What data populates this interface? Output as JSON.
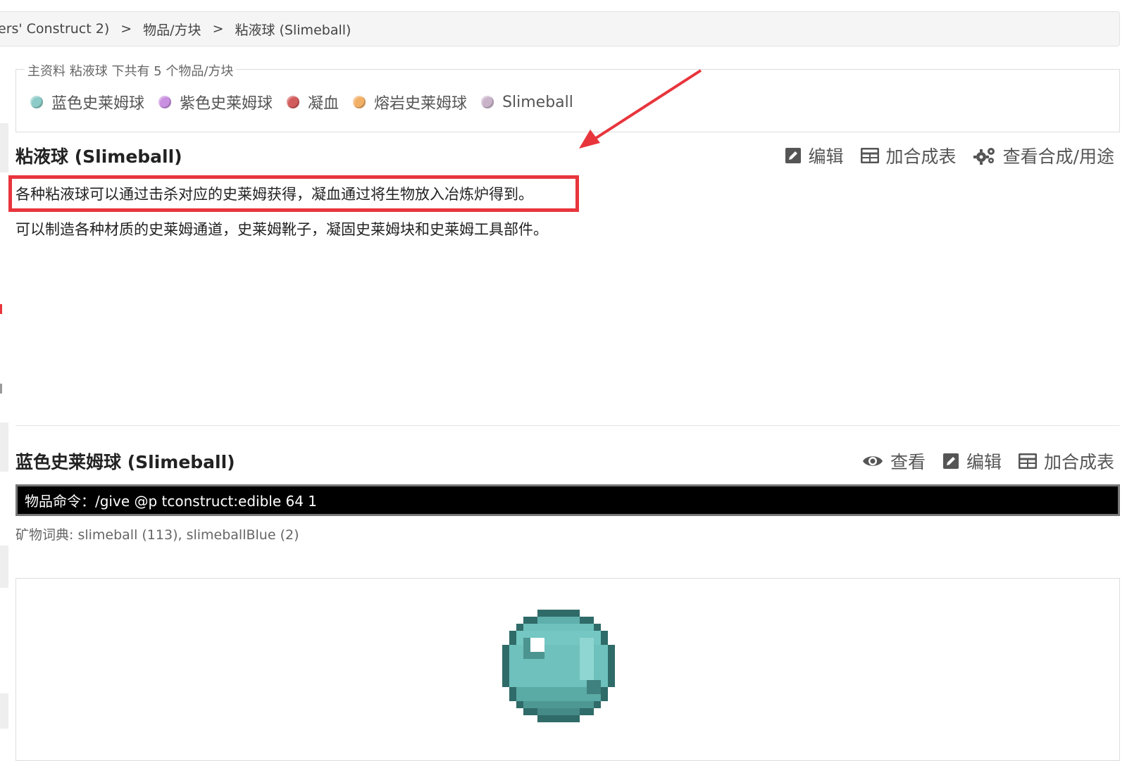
{
  "breadcrumb": {
    "items": [
      "ers' Construct 2)",
      "物品/方块",
      "粘液球 (Slimeball)"
    ],
    "separator": ">"
  },
  "variants_box": {
    "legend": "主资料 粘液球 下共有 5 个物品/方块",
    "items": [
      {
        "label": "蓝色史莱姆球",
        "color": "#8ccbc7"
      },
      {
        "label": "紫色史莱姆球",
        "color": "#c98fe0"
      },
      {
        "label": "凝血",
        "color": "#d25c5c"
      },
      {
        "label": "熔岩史莱姆球",
        "color": "#f2b067"
      },
      {
        "label": "Slimeball",
        "color": "#c9b3c9"
      }
    ]
  },
  "main_item": {
    "title": "粘液球 (Slimeball)",
    "actions": {
      "edit": "编辑",
      "add_recipe": "加合成表",
      "view_usage": "查看合成/用途"
    },
    "description_1": "各种粘液球可以通过击杀对应的史莱姆获得，凝血通过将生物放入冶炼炉得到。",
    "description_2": "可以制造各种材质的史莱姆通道，史莱姆靴子，凝固史莱姆块和史莱姆工具部件。"
  },
  "sub_item": {
    "title": "蓝色史莱姆球 (Slimeball)",
    "actions": {
      "view": "查看",
      "edit": "编辑",
      "add_recipe": "加合成表"
    },
    "command": "物品命令：/give @p tconstruct:edible 64 1",
    "ore_dict": "矿物词典: slimeball (113), slimeballBlue (2)"
  },
  "colors": {
    "annotation_red": "#e8353c",
    "icon_gray": "#555555",
    "slime_blue": "#6ec1bd"
  }
}
